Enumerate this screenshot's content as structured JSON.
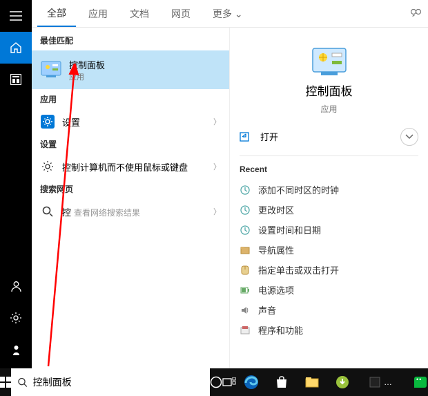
{
  "rail": {
    "items": [
      "menu",
      "home",
      "dashboard"
    ]
  },
  "tabs": {
    "items": [
      "全部",
      "应用",
      "文档",
      "网页",
      "更多"
    ],
    "more_glyph": "⌄",
    "active": 0
  },
  "sections": {
    "best_match": "最佳匹配",
    "apps": "应用",
    "settings_sec": "设置",
    "web": "搜索网页"
  },
  "results": {
    "best": {
      "title": "控制面板",
      "sub": "应用"
    },
    "app_setting": {
      "title": "设置"
    },
    "setting_item": {
      "title": "控制计算机而不使用鼠标或键盘"
    },
    "web_item": {
      "title": "控",
      "sub": "查看网络搜索结果"
    }
  },
  "preview": {
    "title": "控制面板",
    "sub": "应用",
    "open_label": "打开",
    "recent_label": "Recent",
    "recent": [
      "添加不同时区的时钟",
      "更改时区",
      "设置时间和日期",
      "导航属性",
      "指定单击或双击打开",
      "电源选项",
      "声音",
      "程序和功能"
    ]
  },
  "search": {
    "value": "控制面板",
    "typed_display": "控"
  },
  "taskbar": {
    "wechat": "微信"
  }
}
